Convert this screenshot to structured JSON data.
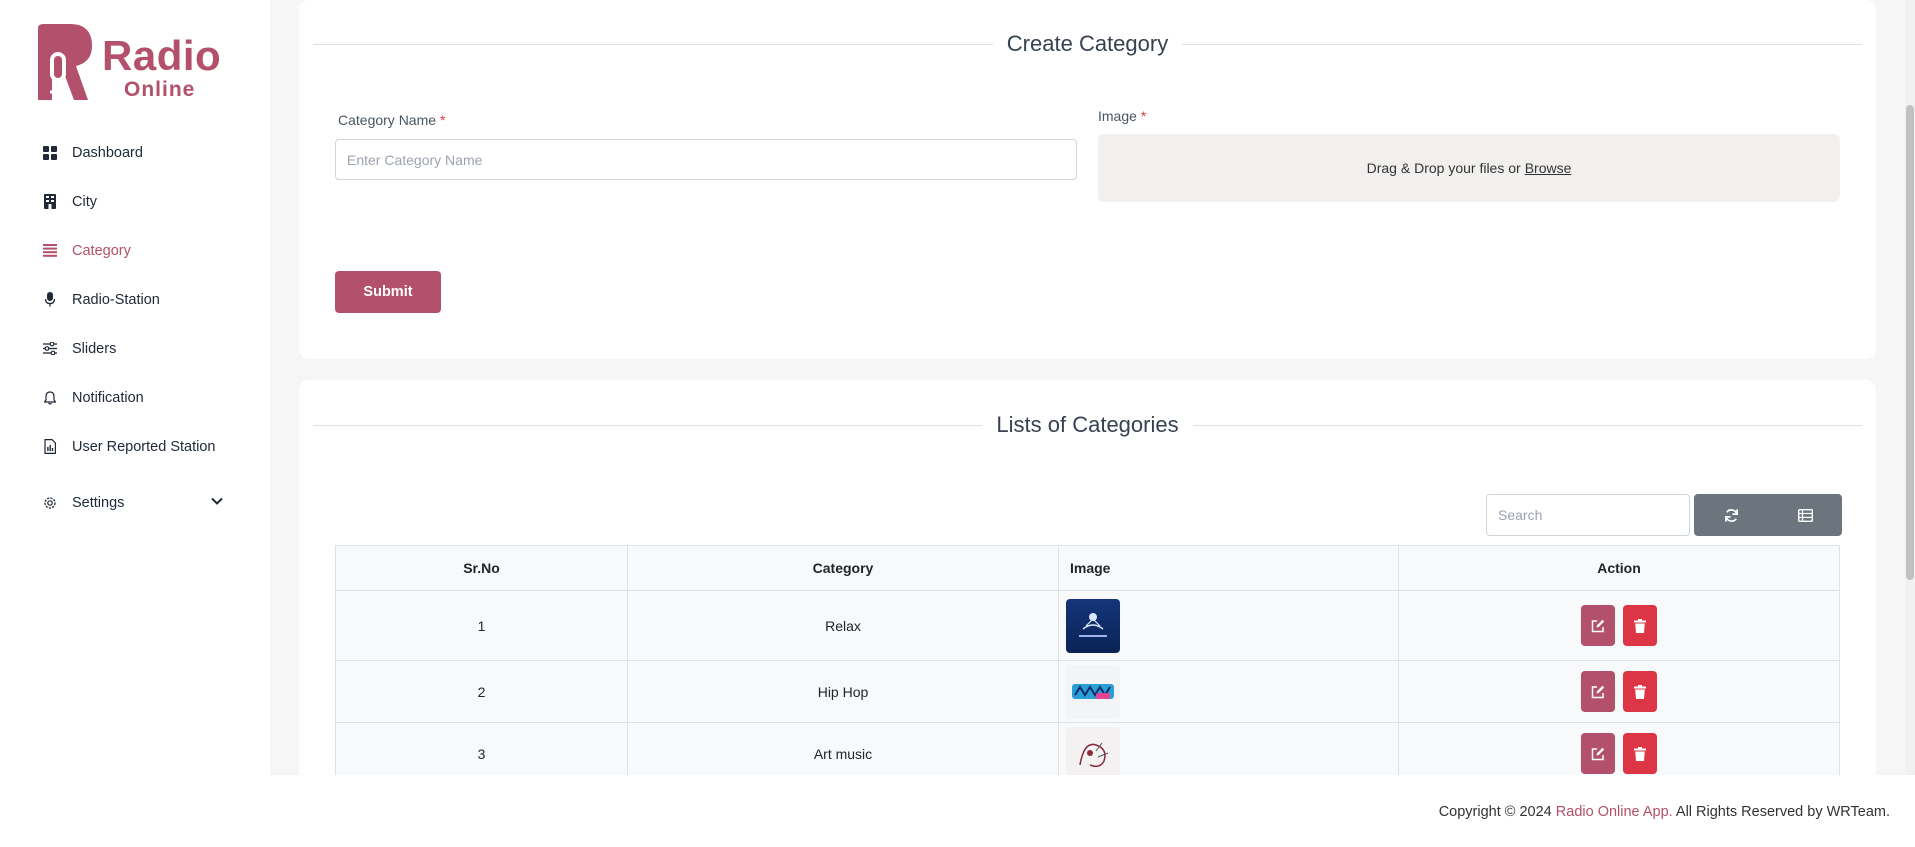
{
  "brand": {
    "name": "Radio",
    "sub": "Online",
    "color": "#b3506b"
  },
  "sidebar": {
    "items": [
      {
        "label": "Dashboard",
        "icon": "dashboard-grid-icon"
      },
      {
        "label": "City",
        "icon": "building-icon"
      },
      {
        "label": "Category",
        "icon": "list-icon",
        "active": true
      },
      {
        "label": "Radio-Station",
        "icon": "microphone-icon"
      },
      {
        "label": "Sliders",
        "icon": "sliders-icon"
      },
      {
        "label": "Notification",
        "icon": "bell-icon"
      },
      {
        "label": "User Reported Station",
        "icon": "report-file-icon"
      },
      {
        "label": "Settings",
        "icon": "gear-icon",
        "expandable": true
      }
    ]
  },
  "create": {
    "title": "Create Category",
    "name_label": "Category Name",
    "name_placeholder": "Enter Category Name",
    "name_value": "",
    "image_label": "Image",
    "required_mark": "*",
    "dropzone_text": "Drag & Drop your files or",
    "dropzone_link": "Browse",
    "submit_label": "Submit"
  },
  "list": {
    "title": "Lists of Categories",
    "search_placeholder": "Search",
    "refresh_icon": "refresh-icon",
    "columns_icon": "columns-toggle-icon",
    "columns": [
      "Sr.No",
      "Category",
      "Image",
      "Action"
    ],
    "rows": [
      {
        "sr": "1",
        "category": "Relax",
        "image": "relax-thumbnail"
      },
      {
        "sr": "2",
        "category": "Hip Hop",
        "image": "hip-hop-thumbnail"
      },
      {
        "sr": "3",
        "category": "Art music",
        "image": "art-music-thumbnail"
      }
    ]
  },
  "footer": {
    "prefix": "Copyright © 2024",
    "brand": "Radio Online App.",
    "suffix": "All Rights Reserved by WRTeam."
  },
  "colors": {
    "accent": "#b3506b",
    "danger": "#dc3545",
    "secondary": "#6c757d"
  }
}
